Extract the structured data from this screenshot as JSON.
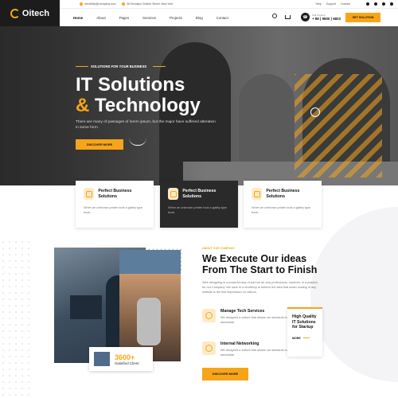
{
  "brand": {
    "logo_text": "Oitech",
    "accent_color": "#f7a518",
    "dark_color": "#1c1c1c"
  },
  "topbar": {
    "email": "needhelp@company.com",
    "address": "80 Brooklyn Golden Street. New York",
    "links": [
      "Help",
      "Support",
      "Contact"
    ],
    "social_icons": [
      "twitter-icon",
      "facebook-icon",
      "pinterest-icon",
      "instagram-icon"
    ]
  },
  "nav": {
    "items": [
      "Home",
      "About",
      "Pages",
      "Services",
      "Projects",
      "Blog",
      "Contact"
    ],
    "active": "Home",
    "phone_label": "Call Anytime",
    "phone_number": "+ 88 ( 9800 ) 6802",
    "cta": "GET SOLUTION"
  },
  "hero": {
    "tag": "SOLUTIONS FOR YOUR BUSINESS",
    "title_line1": "IT Solutions",
    "title_amp": "&",
    "title_line2": "Technology",
    "description": "There are many of passages of lorem ipsum, but the major have suffered alteration in some form.",
    "button": "DISCOVER MORE"
  },
  "features": [
    {
      "title": "Perfect Business Solutions",
      "desc": "When an unknown printer took a galley type book.",
      "icon": "chart-icon"
    },
    {
      "title": "Perfect Business Solutions",
      "desc": "When an unknown printer took a galley type book.",
      "icon": "gear-icon"
    },
    {
      "title": "Perfect Business Solutions",
      "desc": "When an unknown printer took a galley type book.",
      "icon": "target-icon"
    }
  ],
  "stats": {
    "number": "3600+",
    "label": "Satisfied Client"
  },
  "about": {
    "tag": "ABOUT OUR COMPANY",
    "title_we": "We Execute Our ideas",
    "title_line2": "From The Start to Finish",
    "description": "Web designing in a powerful way of just not an only professions, however, in a passion for our Company. We have to a tendency to believe the idea that smart looking of any website is the first impression on visitors.",
    "services": [
      {
        "title": "Manage Tech Services",
        "desc": "We designed a culture that allows our stewards to assimilate.",
        "icon": "tech-icon"
      },
      {
        "title": "Internal Networking",
        "desc": "We designed a culture that allows our stewards to assimilate.",
        "icon": "network-icon"
      }
    ],
    "quality_card": {
      "title": "High Quality IT Solutions for Startup",
      "more": "MORE"
    },
    "button": "DISCOVER MORE"
  }
}
